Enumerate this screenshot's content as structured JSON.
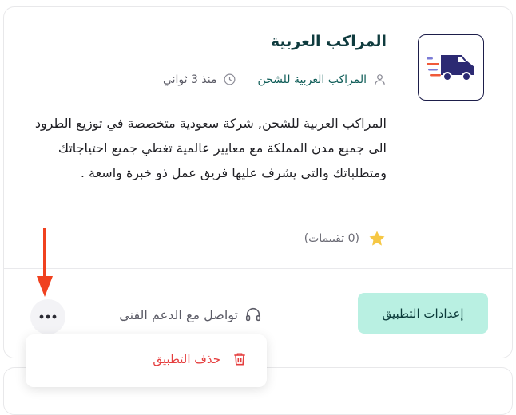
{
  "app": {
    "name": "المراكب العربية",
    "publisher": "المراكب العربية للشحن",
    "published_time": "منذ 3 ثواني",
    "description": "المراكب العربية للشحن, شركة سعودية متخصصة في توزيع الطرود الى جميع مدن المملكة مع معايير عالمية تغطي جميع احتياجاتك ومتطلباتك والتي يشرف عليها فريق عمل ذو خبرة واسعة .",
    "ratings_text": "(0 تقييمات)"
  },
  "actions": {
    "settings_label": "إعدادات التطبيق",
    "support_label": "تواصل مع الدعم الفني",
    "more_label": "•••"
  },
  "menu": {
    "delete_label": "حذف التطبيق"
  },
  "colors": {
    "accent": "#b9f0e2",
    "danger": "#e53e3e",
    "brand_dark": "#0f3b3e",
    "truck": "#2c2a73",
    "annotation_arrow": "#f0411f"
  },
  "icons": [
    "truck-logo-icon",
    "user-icon",
    "clock-icon",
    "star-icon",
    "headphones-icon",
    "more-dots-icon",
    "trash-icon",
    "annotation-arrow"
  ]
}
